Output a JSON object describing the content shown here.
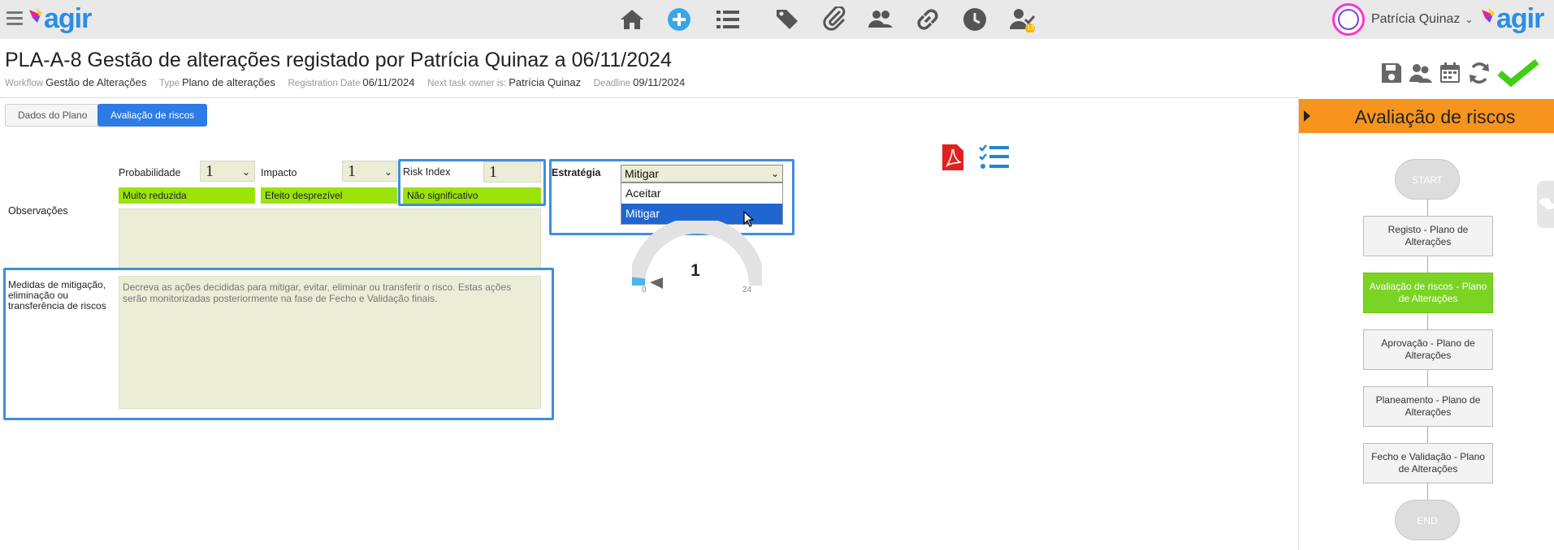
{
  "app": {
    "logo_text": "agir"
  },
  "user": {
    "name": "Patrícia Quinaz",
    "badge_count": "13"
  },
  "header": {
    "title": "PLA-A-8 Gestão de alterações registado por Patrícia Quinaz a 06/11/2024",
    "meta": [
      {
        "key": "Workflow",
        "value": "Gestão de Alterações"
      },
      {
        "key": "Type",
        "value": "Plano de alterações"
      },
      {
        "key": "Registration Date",
        "value": "06/11/2024"
      },
      {
        "key": "Next task owner is:",
        "value": "Patrícia Quinaz"
      },
      {
        "key": "Deadline",
        "value": "09/11/2024"
      }
    ]
  },
  "tabs": [
    {
      "label": "Dados do Plano",
      "active": false
    },
    {
      "label": "Avaliação de riscos",
      "active": true
    }
  ],
  "form": {
    "probabilidade": {
      "label": "Probabilidade",
      "value": "1",
      "desc": "Muito reduzida"
    },
    "impacto": {
      "label": "Impacto",
      "value": "1",
      "desc": "Efeito desprezível"
    },
    "risk_index": {
      "label": "Risk Index",
      "value": "1",
      "desc": "Não significativo"
    },
    "estrategia": {
      "label": "Estratégia",
      "value": "Mitigar",
      "options": [
        "Aceitar",
        "Mitigar"
      ],
      "highlighted": "Mitigar"
    },
    "observacoes": {
      "label": "Observações",
      "value": ""
    },
    "medidas": {
      "label_lines": [
        "Medidas de mitigação,",
        "eliminação ou",
        "transferência de riscos"
      ],
      "placeholder": "Decreva as ações decididas para mitigar, evitar, eliminar ou transferir o risco. Estas ações serão monitorizadas posteriormente na fase de Fecho e Validação finais."
    }
  },
  "gauge": {
    "value": "1",
    "min": "0",
    "max": "24",
    "fraction": 0.042
  },
  "workflow": {
    "title": "Avaliação de riscos",
    "start": "START",
    "end": "END",
    "steps": [
      {
        "label": "Registo - Plano de Alterações",
        "current": false
      },
      {
        "label": "Avaliação de riscos - Plano de Alterações",
        "current": true
      },
      {
        "label": "Aprovação - Plano de Alterações",
        "current": false
      },
      {
        "label": "Planeamento - Plano de Alterações",
        "current": false
      },
      {
        "label": "Fecho e Validação - Plano de Alterações",
        "current": false
      }
    ]
  },
  "colors": {
    "accent": "#2d7be5",
    "orange": "#f7941d",
    "green": "#9be30b",
    "current_step": "#7bd424"
  },
  "icons": {
    "nav": [
      "home-icon",
      "add-icon",
      "list-icon",
      "tags-icon",
      "attachment-icon",
      "users-icon",
      "link-icon",
      "clock-icon",
      "user-check-icon"
    ],
    "actions": [
      "save-icon",
      "group-icon",
      "calendar-icon",
      "refresh-icon",
      "checkmark-icon"
    ]
  }
}
